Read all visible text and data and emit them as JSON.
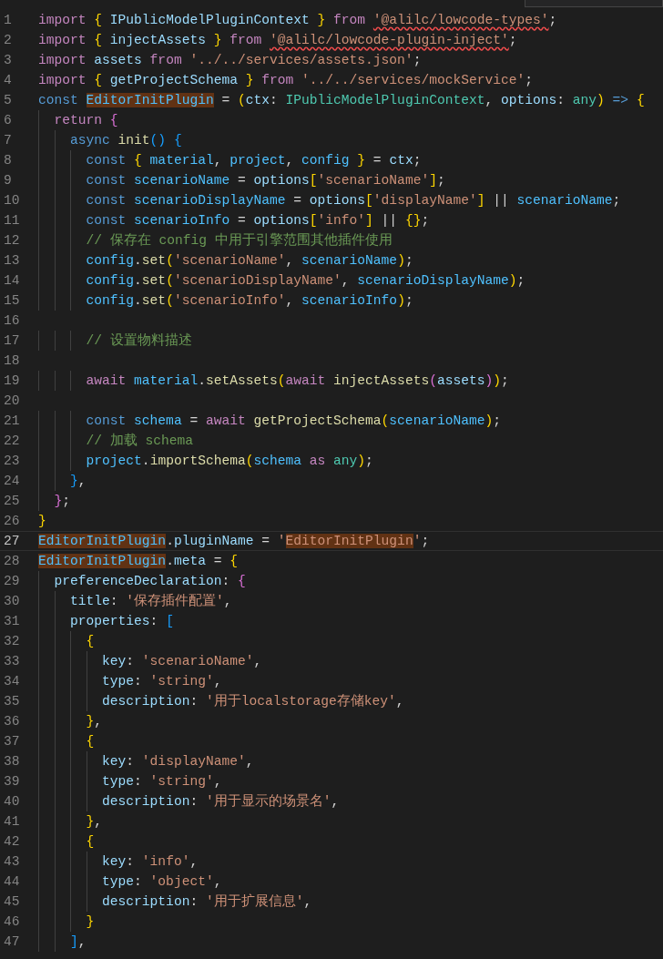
{
  "editor": {
    "hover_widget": {
      "kind": "cut"
    },
    "lines": [
      {
        "number": "1",
        "current": false,
        "tokens": [
          {
            "kind": "ctl",
            "text": "import "
          },
          {
            "kind": "b1",
            "text": "{"
          },
          {
            "kind": "var",
            "text": " IPublicModelPluginContext "
          },
          {
            "kind": "b1",
            "text": "}"
          },
          {
            "kind": "ctl",
            "text": " from "
          },
          {
            "kind": "str",
            "text": "'@alilc/lowcode-types'",
            "error": true
          },
          {
            "kind": "plain",
            "text": ";"
          }
        ]
      },
      {
        "number": "2",
        "current": false,
        "tokens": [
          {
            "kind": "ctl",
            "text": "import "
          },
          {
            "kind": "b1",
            "text": "{"
          },
          {
            "kind": "var",
            "text": " injectAssets "
          },
          {
            "kind": "b1",
            "text": "}"
          },
          {
            "kind": "ctl",
            "text": " from "
          },
          {
            "kind": "str",
            "text": "'@alilc/lowcode-plugin-inject'",
            "error": true
          },
          {
            "kind": "plain",
            "text": ";"
          }
        ]
      },
      {
        "number": "3",
        "current": false,
        "tokens": [
          {
            "kind": "ctl",
            "text": "import"
          },
          {
            "kind": "var",
            "text": " assets"
          },
          {
            "kind": "ctl",
            "text": " from "
          },
          {
            "kind": "str",
            "text": "'../../services/assets.json'"
          },
          {
            "kind": "plain",
            "text": ";"
          }
        ]
      },
      {
        "number": "4",
        "current": false,
        "tokens": [
          {
            "kind": "ctl",
            "text": "import "
          },
          {
            "kind": "b1",
            "text": "{"
          },
          {
            "kind": "var",
            "text": " getProjectSchema "
          },
          {
            "kind": "b1",
            "text": "}"
          },
          {
            "kind": "ctl",
            "text": " from "
          },
          {
            "kind": "str",
            "text": "'../../services/mockService'"
          },
          {
            "kind": "plain",
            "text": ";"
          }
        ]
      },
      {
        "number": "5",
        "current": false,
        "tokens": [
          {
            "kind": "kw",
            "text": "const "
          },
          {
            "kind": "const",
            "text": "EditorInitPlugin",
            "highlighted": true
          },
          {
            "kind": "plain",
            "text": " = "
          },
          {
            "kind": "b1",
            "text": "("
          },
          {
            "kind": "var",
            "text": "ctx"
          },
          {
            "kind": "plain",
            "text": ": "
          },
          {
            "kind": "type",
            "text": "IPublicModelPluginContext"
          },
          {
            "kind": "plain",
            "text": ", "
          },
          {
            "kind": "var",
            "text": "options"
          },
          {
            "kind": "plain",
            "text": ": "
          },
          {
            "kind": "type",
            "text": "any"
          },
          {
            "kind": "b1",
            "text": ")"
          },
          {
            "kind": "kw",
            "text": " => "
          },
          {
            "kind": "b1",
            "text": "{"
          }
        ]
      },
      {
        "number": "6",
        "current": false,
        "tokens": [
          {
            "kind": "ctl",
            "text": "  return "
          },
          {
            "kind": "b2",
            "text": "{"
          }
        ]
      },
      {
        "number": "7",
        "current": false,
        "tokens": [
          {
            "kind": "kw",
            "text": "    async "
          },
          {
            "kind": "fn",
            "text": "init"
          },
          {
            "kind": "b3",
            "text": "() "
          },
          {
            "kind": "b3",
            "text": "{"
          }
        ]
      },
      {
        "number": "8",
        "current": false,
        "tokens": [
          {
            "kind": "kw",
            "text": "      const "
          },
          {
            "kind": "b1",
            "text": "{"
          },
          {
            "kind": "const",
            "text": " material"
          },
          {
            "kind": "plain",
            "text": ", "
          },
          {
            "kind": "const",
            "text": "project"
          },
          {
            "kind": "plain",
            "text": ", "
          },
          {
            "kind": "const",
            "text": "config "
          },
          {
            "kind": "b1",
            "text": "}"
          },
          {
            "kind": "plain",
            "text": " = "
          },
          {
            "kind": "var",
            "text": "ctx"
          },
          {
            "kind": "plain",
            "text": ";"
          }
        ]
      },
      {
        "number": "9",
        "current": false,
        "tokens": [
          {
            "kind": "kw",
            "text": "      const "
          },
          {
            "kind": "const",
            "text": "scenarioName"
          },
          {
            "kind": "plain",
            "text": " = "
          },
          {
            "kind": "var",
            "text": "options"
          },
          {
            "kind": "b1",
            "text": "["
          },
          {
            "kind": "str",
            "text": "'scenarioName'"
          },
          {
            "kind": "b1",
            "text": "]"
          },
          {
            "kind": "plain",
            "text": ";"
          }
        ]
      },
      {
        "number": "10",
        "current": false,
        "tokens": [
          {
            "kind": "kw",
            "text": "      const "
          },
          {
            "kind": "const",
            "text": "scenarioDisplayName"
          },
          {
            "kind": "plain",
            "text": " = "
          },
          {
            "kind": "var",
            "text": "options"
          },
          {
            "kind": "b1",
            "text": "["
          },
          {
            "kind": "str",
            "text": "'displayName'"
          },
          {
            "kind": "b1",
            "text": "]"
          },
          {
            "kind": "plain",
            "text": " || "
          },
          {
            "kind": "const",
            "text": "scenarioName"
          },
          {
            "kind": "plain",
            "text": ";"
          }
        ]
      },
      {
        "number": "11",
        "current": false,
        "tokens": [
          {
            "kind": "kw",
            "text": "      const "
          },
          {
            "kind": "const",
            "text": "scenarioInfo"
          },
          {
            "kind": "plain",
            "text": " = "
          },
          {
            "kind": "var",
            "text": "options"
          },
          {
            "kind": "b1",
            "text": "["
          },
          {
            "kind": "str",
            "text": "'info'"
          },
          {
            "kind": "b1",
            "text": "]"
          },
          {
            "kind": "plain",
            "text": " || "
          },
          {
            "kind": "b1",
            "text": "{}"
          },
          {
            "kind": "plain",
            "text": ";"
          }
        ]
      },
      {
        "number": "12",
        "current": false,
        "tokens": [
          {
            "kind": "comment",
            "text": "      // 保存在 config 中用于引擎范围其他插件使用"
          }
        ]
      },
      {
        "number": "13",
        "current": false,
        "tokens": [
          {
            "kind": "const",
            "text": "      config"
          },
          {
            "kind": "plain",
            "text": "."
          },
          {
            "kind": "fn",
            "text": "set"
          },
          {
            "kind": "b1",
            "text": "("
          },
          {
            "kind": "str",
            "text": "'scenarioName'"
          },
          {
            "kind": "plain",
            "text": ", "
          },
          {
            "kind": "const",
            "text": "scenarioName"
          },
          {
            "kind": "b1",
            "text": ")"
          },
          {
            "kind": "plain",
            "text": ";"
          }
        ]
      },
      {
        "number": "14",
        "current": false,
        "tokens": [
          {
            "kind": "const",
            "text": "      config"
          },
          {
            "kind": "plain",
            "text": "."
          },
          {
            "kind": "fn",
            "text": "set"
          },
          {
            "kind": "b1",
            "text": "("
          },
          {
            "kind": "str",
            "text": "'scenarioDisplayName'"
          },
          {
            "kind": "plain",
            "text": ", "
          },
          {
            "kind": "const",
            "text": "scenarioDisplayName"
          },
          {
            "kind": "b1",
            "text": ")"
          },
          {
            "kind": "plain",
            "text": ";"
          }
        ]
      },
      {
        "number": "15",
        "current": false,
        "tokens": [
          {
            "kind": "const",
            "text": "      config"
          },
          {
            "kind": "plain",
            "text": "."
          },
          {
            "kind": "fn",
            "text": "set"
          },
          {
            "kind": "b1",
            "text": "("
          },
          {
            "kind": "str",
            "text": "'scenarioInfo'"
          },
          {
            "kind": "plain",
            "text": ", "
          },
          {
            "kind": "const",
            "text": "scenarioInfo"
          },
          {
            "kind": "b1",
            "text": ")"
          },
          {
            "kind": "plain",
            "text": ";"
          }
        ]
      },
      {
        "number": "16",
        "current": false
      },
      {
        "number": "17",
        "current": false,
        "tokens": [
          {
            "kind": "comment",
            "text": "      // 设置物料描述"
          }
        ]
      },
      {
        "number": "18",
        "current": false
      },
      {
        "number": "19",
        "current": false,
        "tokens": [
          {
            "kind": "ctl",
            "text": "      await "
          },
          {
            "kind": "const",
            "text": "material"
          },
          {
            "kind": "plain",
            "text": "."
          },
          {
            "kind": "fn",
            "text": "setAssets"
          },
          {
            "kind": "b1",
            "text": "("
          },
          {
            "kind": "ctl",
            "text": "await "
          },
          {
            "kind": "fn",
            "text": "injectAssets"
          },
          {
            "kind": "b2",
            "text": "("
          },
          {
            "kind": "var",
            "text": "assets"
          },
          {
            "kind": "b2",
            "text": ")"
          },
          {
            "kind": "b1",
            "text": ")"
          },
          {
            "kind": "plain",
            "text": ";"
          }
        ]
      },
      {
        "number": "20",
        "current": false
      },
      {
        "number": "21",
        "current": false,
        "tokens": [
          {
            "kind": "kw",
            "text": "      const "
          },
          {
            "kind": "const",
            "text": "schema"
          },
          {
            "kind": "plain",
            "text": " = "
          },
          {
            "kind": "ctl",
            "text": "await "
          },
          {
            "kind": "fn",
            "text": "getProjectSchema"
          },
          {
            "kind": "b1",
            "text": "("
          },
          {
            "kind": "const",
            "text": "scenarioName"
          },
          {
            "kind": "b1",
            "text": ")"
          },
          {
            "kind": "plain",
            "text": ";"
          }
        ]
      },
      {
        "number": "22",
        "current": false,
        "tokens": [
          {
            "kind": "comment",
            "text": "      // 加载 schema"
          }
        ]
      },
      {
        "number": "23",
        "current": false,
        "tokens": [
          {
            "kind": "const",
            "text": "      project"
          },
          {
            "kind": "plain",
            "text": "."
          },
          {
            "kind": "fn",
            "text": "importSchema"
          },
          {
            "kind": "b1",
            "text": "("
          },
          {
            "kind": "const",
            "text": "schema"
          },
          {
            "kind": "ctl",
            "text": " as "
          },
          {
            "kind": "type",
            "text": "any"
          },
          {
            "kind": "b1",
            "text": ")"
          },
          {
            "kind": "plain",
            "text": ";"
          }
        ]
      },
      {
        "number": "24",
        "current": false,
        "tokens": [
          {
            "kind": "b3",
            "text": "    }"
          },
          {
            "kind": "plain",
            "text": ","
          }
        ]
      },
      {
        "number": "25",
        "current": false,
        "tokens": [
          {
            "kind": "b2",
            "text": "  }"
          },
          {
            "kind": "plain",
            "text": ";"
          }
        ]
      },
      {
        "number": "26",
        "current": false,
        "tokens": [
          {
            "kind": "b1",
            "text": "}"
          }
        ]
      },
      {
        "number": "27",
        "current": true,
        "tokens": [
          {
            "kind": "const",
            "text": "EditorInitPlugin",
            "highlighted": true
          },
          {
            "kind": "plain",
            "text": "."
          },
          {
            "kind": "var",
            "text": "pluginName"
          },
          {
            "kind": "plain",
            "text": " = "
          },
          {
            "kind": "str",
            "text": "'"
          },
          {
            "kind": "str",
            "text": "EditorInitPlugin",
            "highlighted": true
          },
          {
            "kind": "str",
            "text": "'"
          },
          {
            "kind": "plain",
            "text": ";"
          }
        ]
      },
      {
        "number": "28",
        "current": false,
        "tokens": [
          {
            "kind": "const",
            "text": "EditorInitPlugin",
            "highlighted": true
          },
          {
            "kind": "plain",
            "text": "."
          },
          {
            "kind": "var",
            "text": "meta"
          },
          {
            "kind": "plain",
            "text": " = "
          },
          {
            "kind": "b1",
            "text": "{"
          }
        ]
      },
      {
        "number": "29",
        "current": false,
        "tokens": [
          {
            "kind": "var",
            "text": "  preferenceDeclaration"
          },
          {
            "kind": "plain",
            "text": ": "
          },
          {
            "kind": "b2",
            "text": "{"
          }
        ]
      },
      {
        "number": "30",
        "current": false,
        "tokens": [
          {
            "kind": "var",
            "text": "    title"
          },
          {
            "kind": "plain",
            "text": ": "
          },
          {
            "kind": "str",
            "text": "'保存插件配置'"
          },
          {
            "kind": "plain",
            "text": ","
          }
        ]
      },
      {
        "number": "31",
        "current": false,
        "tokens": [
          {
            "kind": "var",
            "text": "    properties"
          },
          {
            "kind": "plain",
            "text": ": "
          },
          {
            "kind": "b3",
            "text": "["
          }
        ]
      },
      {
        "number": "32",
        "current": false,
        "tokens": [
          {
            "kind": "b1",
            "text": "      {"
          }
        ]
      },
      {
        "number": "33",
        "current": false,
        "tokens": [
          {
            "kind": "var",
            "text": "        key"
          },
          {
            "kind": "plain",
            "text": ": "
          },
          {
            "kind": "str",
            "text": "'scenarioName'"
          },
          {
            "kind": "plain",
            "text": ","
          }
        ]
      },
      {
        "number": "34",
        "current": false,
        "tokens": [
          {
            "kind": "var",
            "text": "        type"
          },
          {
            "kind": "plain",
            "text": ": "
          },
          {
            "kind": "str",
            "text": "'string'"
          },
          {
            "kind": "plain",
            "text": ","
          }
        ]
      },
      {
        "number": "35",
        "current": false,
        "tokens": [
          {
            "kind": "var",
            "text": "        description"
          },
          {
            "kind": "plain",
            "text": ": "
          },
          {
            "kind": "str",
            "text": "'用于localstorage存储key'"
          },
          {
            "kind": "plain",
            "text": ","
          }
        ]
      },
      {
        "number": "36",
        "current": false,
        "tokens": [
          {
            "kind": "b1",
            "text": "      }"
          },
          {
            "kind": "plain",
            "text": ","
          }
        ]
      },
      {
        "number": "37",
        "current": false,
        "tokens": [
          {
            "kind": "b1",
            "text": "      {"
          }
        ]
      },
      {
        "number": "38",
        "current": false,
        "tokens": [
          {
            "kind": "var",
            "text": "        key"
          },
          {
            "kind": "plain",
            "text": ": "
          },
          {
            "kind": "str",
            "text": "'displayName'"
          },
          {
            "kind": "plain",
            "text": ","
          }
        ]
      },
      {
        "number": "39",
        "current": false,
        "tokens": [
          {
            "kind": "var",
            "text": "        type"
          },
          {
            "kind": "plain",
            "text": ": "
          },
          {
            "kind": "str",
            "text": "'string'"
          },
          {
            "kind": "plain",
            "text": ","
          }
        ]
      },
      {
        "number": "40",
        "current": false,
        "tokens": [
          {
            "kind": "var",
            "text": "        description"
          },
          {
            "kind": "plain",
            "text": ": "
          },
          {
            "kind": "str",
            "text": "'用于显示的场景名'"
          },
          {
            "kind": "plain",
            "text": ","
          }
        ]
      },
      {
        "number": "41",
        "current": false,
        "tokens": [
          {
            "kind": "b1",
            "text": "      }"
          },
          {
            "kind": "plain",
            "text": ","
          }
        ]
      },
      {
        "number": "42",
        "current": false,
        "tokens": [
          {
            "kind": "b1",
            "text": "      {"
          }
        ]
      },
      {
        "number": "43",
        "current": false,
        "tokens": [
          {
            "kind": "var",
            "text": "        key"
          },
          {
            "kind": "plain",
            "text": ": "
          },
          {
            "kind": "str",
            "text": "'info'"
          },
          {
            "kind": "plain",
            "text": ","
          }
        ]
      },
      {
        "number": "44",
        "current": false,
        "tokens": [
          {
            "kind": "var",
            "text": "        type"
          },
          {
            "kind": "plain",
            "text": ": "
          },
          {
            "kind": "str",
            "text": "'object'"
          },
          {
            "kind": "plain",
            "text": ","
          }
        ]
      },
      {
        "number": "45",
        "current": false,
        "tokens": [
          {
            "kind": "var",
            "text": "        description"
          },
          {
            "kind": "plain",
            "text": ": "
          },
          {
            "kind": "str",
            "text": "'用于扩展信息'"
          },
          {
            "kind": "plain",
            "text": ","
          }
        ]
      },
      {
        "number": "46",
        "current": false,
        "tokens": [
          {
            "kind": "b1",
            "text": "      }"
          }
        ]
      },
      {
        "number": "47",
        "current": false,
        "tokens": [
          {
            "kind": "b3",
            "text": "    ]"
          },
          {
            "kind": "plain",
            "text": ","
          }
        ]
      }
    ]
  }
}
